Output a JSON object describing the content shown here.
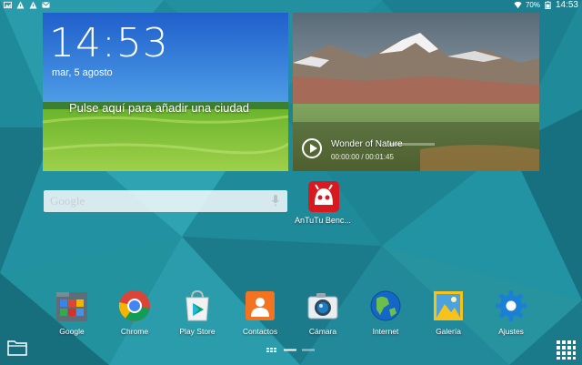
{
  "status_bar": {
    "left_icons": [
      "image-notification-icon",
      "warning-notification-icon",
      "warning-notification-icon",
      "message-notification-icon"
    ],
    "wifi_icon": "wifi-icon",
    "battery_text": "70%",
    "battery_icon": "battery-icon",
    "time": "14:53"
  },
  "clock_widget": {
    "time": "14:53",
    "date": "mar, 5 agosto",
    "city_prompt": "Pulse aquí para añadir una ciudad"
  },
  "video_widget": {
    "title": "Wonder of Nature",
    "elapsed_time": "00:00:00 / 00:01:45",
    "play_icon": "play-icon",
    "progress": 0
  },
  "search_bar": {
    "logo_text": "Google",
    "mic_icon": "mic-icon"
  },
  "home_shortcuts": [
    {
      "label": "AnTuTu Benc...",
      "icon": "antutu-icon"
    }
  ],
  "dock": [
    {
      "label": "Google",
      "icon": "google-folder-icon"
    },
    {
      "label": "Chrome",
      "icon": "chrome-icon"
    },
    {
      "label": "Play Store",
      "icon": "play-store-icon"
    },
    {
      "label": "Contactos",
      "icon": "contacts-icon"
    },
    {
      "label": "Cámara",
      "icon": "camera-icon"
    },
    {
      "label": "Internet",
      "icon": "internet-globe-icon"
    },
    {
      "label": "Galería",
      "icon": "gallery-icon"
    },
    {
      "label": "Ajustes",
      "icon": "settings-gear-icon"
    }
  ],
  "bottom_bar": {
    "folder_icon": "folder-icon",
    "page_indicator": {
      "page_count": 3,
      "current_page": 2
    },
    "apps_icon": "apps-grid-icon"
  },
  "colors": {
    "wallpaper_base": "#1f8a9a",
    "clock_sky_top": "#1f63c9",
    "grass": "#7fc23a",
    "search_bar": "#eef3f5",
    "antutu_red": "#d71920"
  }
}
